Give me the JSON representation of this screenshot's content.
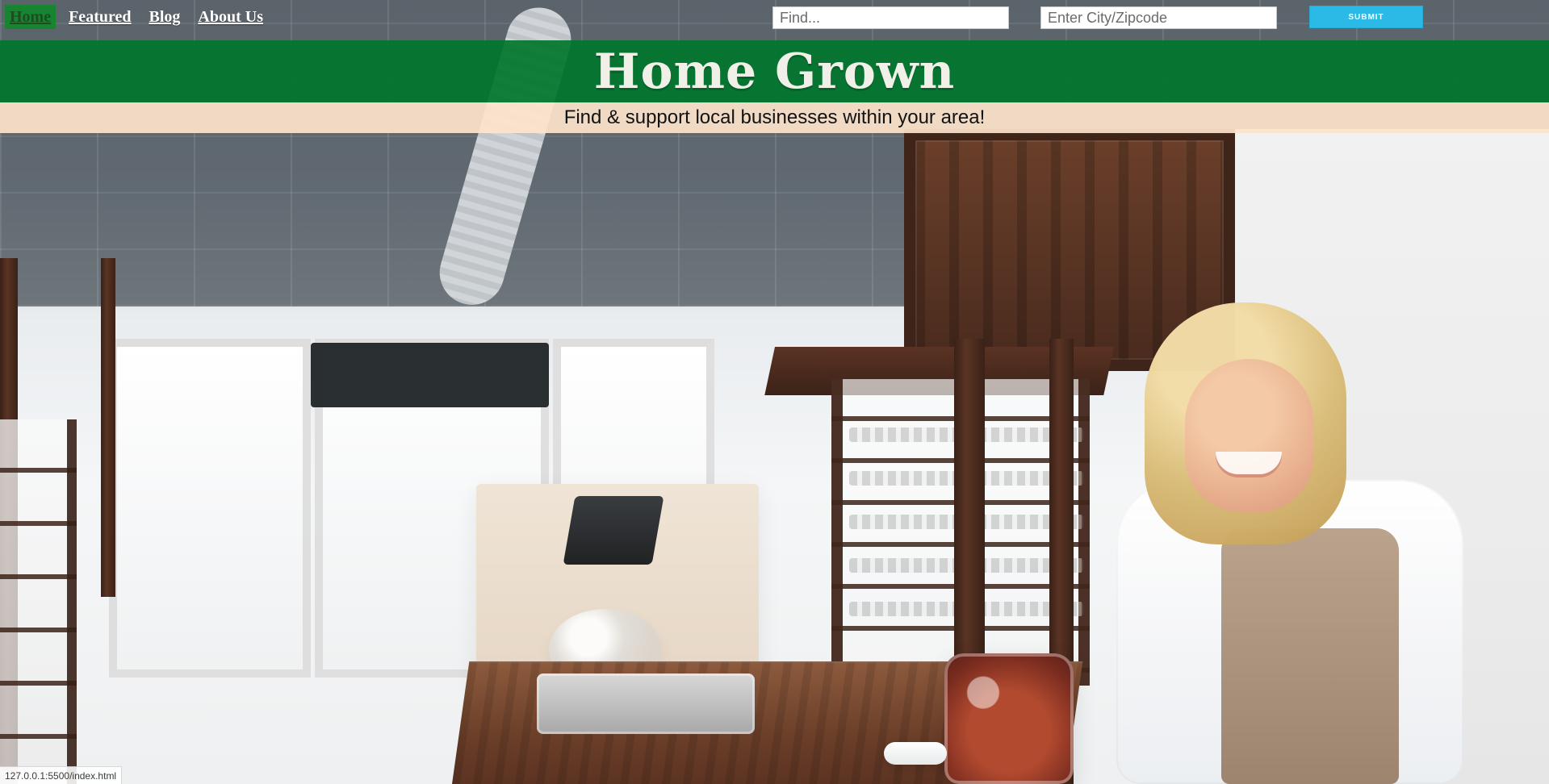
{
  "nav": {
    "items": [
      {
        "label": "Home",
        "active": true
      },
      {
        "label": "Featured",
        "active": false
      },
      {
        "label": "Blog",
        "active": false
      },
      {
        "label": "About Us",
        "active": false
      }
    ]
  },
  "search": {
    "find_placeholder": "Find...",
    "city_placeholder": "Enter City/Zipcode",
    "submit_label": "SUBMIT"
  },
  "hero": {
    "title": "Home Grown",
    "tagline": "Find & support local businesses within your area!"
  },
  "status": {
    "url": "127.0.0.1:5500/index.html"
  },
  "colors": {
    "title_band": "#00762C",
    "tagline_band": "#FDE4CB",
    "submit": "#2BB9E6",
    "nav_active_bg": "#14862E"
  }
}
